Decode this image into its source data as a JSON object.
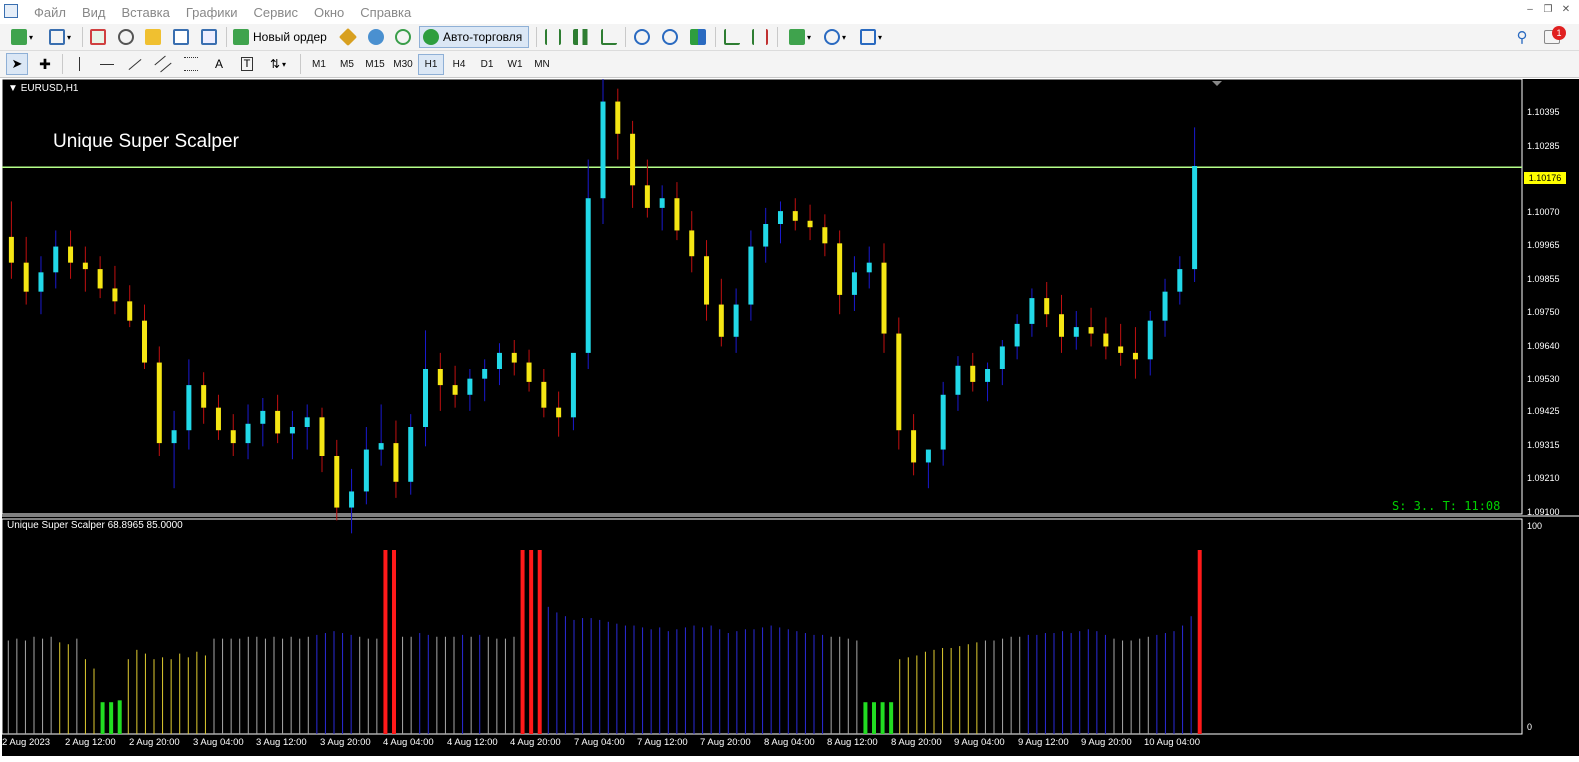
{
  "menubar": {
    "items": [
      "Файл",
      "Вид",
      "Вставка",
      "Графики",
      "Сервис",
      "Окно",
      "Справка"
    ],
    "window_controls": [
      "minimize-icon",
      "restore-icon",
      "close-icon"
    ]
  },
  "toolbar1": {
    "new_order_label": "Новый ордер",
    "auto_trading_label": "Авто-торговля",
    "notification_count": "1",
    "colors": {
      "auto_trading_icon": "#2e9e3e",
      "notification_badge": "#e02020"
    }
  },
  "toolbar2": {
    "timeframes": [
      "M1",
      "M5",
      "M15",
      "M30",
      "H1",
      "H4",
      "D1",
      "W1",
      "MN"
    ],
    "active_timeframe": "H1"
  },
  "chart": {
    "symbol_label": "EURUSD,H1",
    "indicator_title": "Unique Super Scalper",
    "subwindow_label": "Unique Super Scalper 68.8965 85.0000",
    "status_text": "S: 3.. T: 11:08",
    "current_price": "1.10176",
    "price_labels": [
      "1.10395",
      "1.10285",
      "1.10070",
      "1.09965",
      "1.09855",
      "1.09750",
      "1.09640",
      "1.09530",
      "1.09425",
      "1.09315",
      "1.09210",
      "1.09100"
    ],
    "subwindow_scale": [
      "100",
      "0"
    ],
    "date_labels": [
      "2 Aug 2023",
      "2 Aug 12:00",
      "2 Aug 20:00",
      "3 Aug 04:00",
      "3 Aug 12:00",
      "3 Aug 20:00",
      "4 Aug 04:00",
      "4 Aug 12:00",
      "4 Aug 20:00",
      "7 Aug 04:00",
      "7 Aug 12:00",
      "7 Aug 20:00",
      "8 Aug 04:00",
      "8 Aug 12:00",
      "8 Aug 20:00",
      "9 Aug 04:00",
      "9 Aug 12:00",
      "9 Aug 20:00",
      "10 Aug 04:00"
    ],
    "colors": {
      "background": "#000000",
      "bull_candle": "#22d8e8",
      "bear_candle": "#f5e614",
      "bull_wick": "#1a1ad0",
      "bear_wick": "#c01010",
      "level_line": "#b6ff8a",
      "status": "#00d000",
      "current_price_bg": "#ffff00"
    }
  },
  "chart_data": {
    "type": "bar",
    "title": "Unique Super Scalper",
    "symbol": "EURUSD,H1",
    "ylim": [
      1.091,
      1.1045
    ],
    "level_line": 1.10176,
    "candles": [
      [
        1.0996,
        1.1007,
        1.0983,
        1.0988
      ],
      [
        1.0988,
        1.0996,
        1.0975,
        1.0979
      ],
      [
        1.0979,
        1.099,
        1.0972,
        1.0985
      ],
      [
        1.0985,
        1.0998,
        1.098,
        1.0993
      ],
      [
        1.0993,
        1.0998,
        1.0983,
        1.0988
      ],
      [
        1.0988,
        1.0993,
        1.0979,
        1.0986
      ],
      [
        1.0986,
        1.099,
        1.0977,
        1.098
      ],
      [
        1.098,
        1.0987,
        1.0972,
        1.0976
      ],
      [
        1.0976,
        1.0981,
        1.0968,
        1.097
      ],
      [
        1.097,
        1.0975,
        1.0955,
        1.0957
      ],
      [
        1.0957,
        1.0962,
        1.0928,
        1.0932
      ],
      [
        1.0932,
        1.0942,
        1.0918,
        1.0936
      ],
      [
        1.0936,
        1.0958,
        1.093,
        1.095
      ],
      [
        1.095,
        1.0954,
        1.0938,
        1.0943
      ],
      [
        1.0943,
        1.0947,
        1.0933,
        1.0936
      ],
      [
        1.0936,
        1.0941,
        1.0928,
        1.0932
      ],
      [
        1.0932,
        1.0944,
        1.0927,
        1.0938
      ],
      [
        1.0938,
        1.0946,
        1.0931,
        1.0942
      ],
      [
        1.0942,
        1.0947,
        1.0932,
        1.0935
      ],
      [
        1.0935,
        1.0942,
        1.0927,
        1.0937
      ],
      [
        1.0937,
        1.0944,
        1.093,
        1.094
      ],
      [
        1.094,
        1.0943,
        1.0923,
        1.0928
      ],
      [
        1.0928,
        1.0933,
        1.0908,
        1.0912
      ],
      [
        1.0912,
        1.0924,
        1.0904,
        1.0917
      ],
      [
        1.0917,
        1.0937,
        1.0913,
        1.093
      ],
      [
        1.093,
        1.0944,
        1.0925,
        1.0932
      ],
      [
        1.0932,
        1.0939,
        1.0915,
        1.092
      ],
      [
        1.092,
        1.0941,
        1.0916,
        1.0937
      ],
      [
        1.0937,
        1.0967,
        1.0931,
        1.0955
      ],
      [
        1.0955,
        1.096,
        1.0942,
        1.095
      ],
      [
        1.095,
        1.0956,
        1.0943,
        1.0947
      ],
      [
        1.0947,
        1.0955,
        1.0942,
        1.0952
      ],
      [
        1.0952,
        1.0958,
        1.0945,
        1.0955
      ],
      [
        1.0955,
        1.0963,
        1.095,
        1.096
      ],
      [
        1.096,
        1.0964,
        1.0953,
        1.0957
      ],
      [
        1.0957,
        1.0961,
        1.0948,
        1.0951
      ],
      [
        1.0951,
        1.0955,
        1.094,
        1.0943
      ],
      [
        1.0943,
        1.0948,
        1.0934,
        1.094
      ],
      [
        1.094,
        1.0955,
        1.0936,
        1.096
      ],
      [
        1.096,
        1.102,
        1.0955,
        1.1008
      ],
      [
        1.1008,
        1.1045,
        1.1,
        1.1038
      ],
      [
        1.1038,
        1.1042,
        1.102,
        1.1028
      ],
      [
        1.1028,
        1.1032,
        1.1005,
        1.1012
      ],
      [
        1.1012,
        1.102,
        1.1002,
        1.1005
      ],
      [
        1.1005,
        1.1012,
        1.0998,
        1.1008
      ],
      [
        1.1008,
        1.1013,
        1.0995,
        1.0998
      ],
      [
        1.0998,
        1.1004,
        1.0985,
        1.099
      ],
      [
        1.099,
        1.0995,
        1.097,
        1.0975
      ],
      [
        1.0975,
        1.0983,
        1.0962,
        1.0965
      ],
      [
        1.0965,
        1.098,
        1.096,
        1.0975
      ],
      [
        1.0975,
        1.0998,
        1.097,
        1.0993
      ],
      [
        1.0993,
        1.1005,
        1.0988,
        1.1
      ],
      [
        1.1,
        1.1007,
        1.0994,
        1.1004
      ],
      [
        1.1004,
        1.1008,
        1.0998,
        1.1001
      ],
      [
        1.1001,
        1.1006,
        1.0995,
        1.0999
      ],
      [
        1.0999,
        1.1003,
        1.099,
        1.0994
      ],
      [
        1.0994,
        1.0998,
        1.0972,
        1.0978
      ],
      [
        1.0978,
        1.099,
        1.0973,
        1.0985
      ],
      [
        1.0985,
        1.0993,
        1.098,
        1.0988
      ],
      [
        1.0988,
        1.0994,
        1.096,
        1.0966
      ],
      [
        1.0966,
        1.0971,
        1.093,
        1.0936
      ],
      [
        1.0936,
        1.0941,
        1.0922,
        1.0926
      ],
      [
        1.0926,
        1.093,
        1.0918,
        1.093
      ],
      [
        1.093,
        1.0951,
        1.0925,
        1.0947
      ],
      [
        1.0947,
        1.0959,
        1.0942,
        1.0956
      ],
      [
        1.0956,
        1.096,
        1.0948,
        1.0951
      ],
      [
        1.0951,
        1.0957,
        1.0945,
        1.0955
      ],
      [
        1.0955,
        1.0964,
        1.095,
        1.0962
      ],
      [
        1.0962,
        1.0972,
        1.0958,
        1.0969
      ],
      [
        1.0969,
        1.098,
        1.0965,
        1.0977
      ],
      [
        1.0977,
        1.0982,
        1.0968,
        1.0972
      ],
      [
        1.0972,
        1.0978,
        1.096,
        1.0965
      ],
      [
        1.0965,
        1.0973,
        1.0961,
        1.0968
      ],
      [
        1.0968,
        1.0974,
        1.0962,
        1.0966
      ],
      [
        1.0966,
        1.0971,
        1.0958,
        1.0962
      ],
      [
        1.0962,
        1.0969,
        1.0956,
        1.096
      ],
      [
        1.096,
        1.0968,
        1.0952,
        1.0958
      ],
      [
        1.0958,
        1.0973,
        1.0953,
        1.097
      ],
      [
        1.097,
        1.0983,
        1.0965,
        1.0979
      ],
      [
        1.0979,
        1.099,
        1.0975,
        1.0986
      ],
      [
        1.0986,
        1.103,
        1.0982,
        1.1018
      ]
    ],
    "indicator": {
      "ylim": [
        0,
        100
      ],
      "values": [
        50,
        51,
        50,
        52,
        51,
        52,
        49,
        48,
        51,
        40,
        35,
        17,
        17,
        18,
        40,
        45,
        43,
        40,
        41,
        40,
        43,
        41,
        44,
        42,
        51,
        51,
        51,
        51,
        52,
        52,
        51,
        52,
        51,
        52,
        51,
        52,
        53,
        54,
        55,
        54,
        53,
        52,
        51,
        51,
        100,
        100,
        52,
        52,
        54,
        53,
        52,
        52,
        52,
        53,
        52,
        53,
        52,
        51,
        51,
        52,
        100,
        100,
        100,
        68,
        65,
        63,
        61,
        62,
        62,
        61,
        60,
        59,
        58,
        58,
        57,
        56,
        57,
        55,
        56,
        57,
        58,
        57,
        58,
        56,
        54,
        55,
        56,
        56,
        57,
        58,
        57,
        56,
        55,
        54,
        53,
        53,
        52,
        52,
        51,
        50,
        17,
        17,
        17,
        17,
        40,
        41,
        42,
        44,
        45,
        46,
        46,
        47,
        48,
        49,
        50,
        50,
        51,
        52,
        52,
        53,
        53,
        54,
        54,
        55,
        54,
        55,
        56,
        55,
        53,
        51,
        50,
        50,
        51,
        52,
        53,
        54,
        55,
        58,
        63,
        100
      ]
    }
  }
}
